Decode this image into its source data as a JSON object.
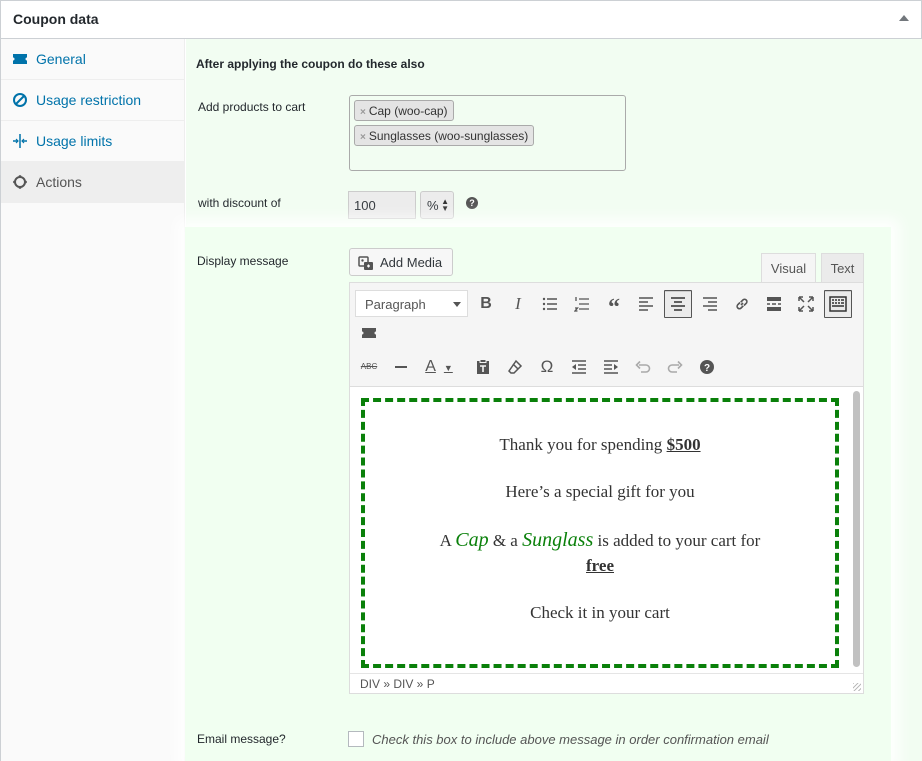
{
  "panel": {
    "title": "Coupon data"
  },
  "sidebar": {
    "items": [
      {
        "label": "General",
        "icon": "ticket-icon"
      },
      {
        "label": "Usage restriction",
        "icon": "block-icon"
      },
      {
        "label": "Usage limits",
        "icon": "limits-icon"
      },
      {
        "label": "Actions",
        "icon": "gear-icon",
        "active": true
      }
    ]
  },
  "main": {
    "section_heading": "After applying the coupon do these also",
    "add_products_label": "Add products to cart",
    "products": [
      "Cap (woo-cap)",
      "Sunglasses (woo-sunglasses)"
    ],
    "chip_remove": "×",
    "discount_label": "with discount of",
    "discount_value": "100",
    "discount_type": "%",
    "help_glyph": "?",
    "display_message_label": "Display message",
    "email_label": "Email message?",
    "email_description": "Check this box to include above message in order confirmation email"
  },
  "editor": {
    "add_media_label": "Add Media",
    "tab_visual": "Visual",
    "tab_text": "Text",
    "format_value": "Paragraph",
    "status_path": "DIV » DIV » P",
    "content": {
      "line1_prefix": "Thank you for spending ",
      "line1_amount": "$500",
      "line2": "Here’s a special gift for you",
      "line3_a": "A ",
      "line3_cap": "Cap",
      "line3_amp": " & a ",
      "line3_sunglass": "Sunglass",
      "line3_suffix": " is added to your cart for",
      "line4": "free",
      "line5": "Check it in your cart"
    }
  },
  "colors": {
    "accent": "#0073aa",
    "highlight_bg": "#f1fff1",
    "dashed_border": "#0a800a"
  }
}
